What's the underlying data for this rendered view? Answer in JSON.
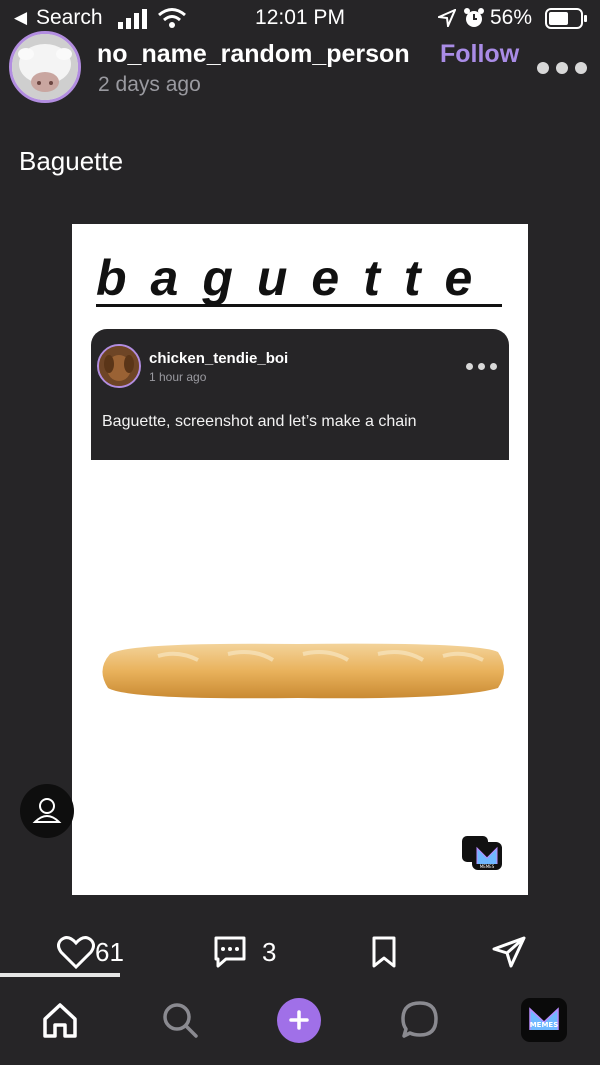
{
  "status_bar": {
    "back_label": "Search",
    "time": "12:01 PM",
    "battery_percent": "56%"
  },
  "post": {
    "username": "no_name_random_person",
    "time_ago": "2 days ago",
    "follow_label": "Follow",
    "title": "Baguette"
  },
  "meme": {
    "heading": "baguette",
    "inner_post": {
      "username": "chicken_tendie_boi",
      "time_ago": "1 hour ago",
      "text": "Baguette, screenshot and let’s make a chain"
    },
    "watermark": "MEMES"
  },
  "actions": {
    "likes": "61",
    "comments": "3"
  },
  "tab_bar": {
    "memes_label": "MEMES"
  },
  "colors": {
    "background": "#262527",
    "accent": "#a98ce6",
    "plus_button": "#a070e8"
  },
  "icons": [
    "back-arrow-icon",
    "signal-icon",
    "wifi-icon",
    "location-icon",
    "alarm-icon",
    "battery-icon",
    "more-icon",
    "profile-icon",
    "heart-icon",
    "comment-icon",
    "bookmark-icon",
    "share-icon",
    "home-icon",
    "search-icon",
    "plus-icon",
    "chat-icon",
    "memes-app-icon"
  ]
}
